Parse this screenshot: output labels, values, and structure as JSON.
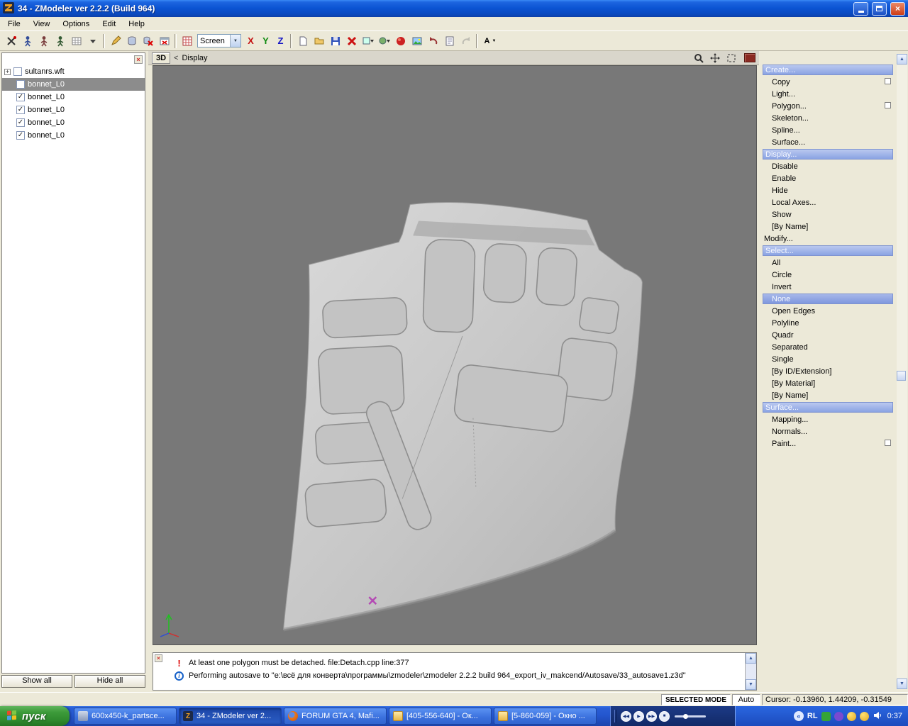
{
  "window": {
    "title": "34 - ZModeler ver 2.2.2 (Build 964)"
  },
  "menu": {
    "items": [
      "File",
      "View",
      "Options",
      "Edit",
      "Help"
    ]
  },
  "toolbar": {
    "screen_combo_value": "Screen",
    "axis_x": "X",
    "axis_y": "Y",
    "axis_z": "Z",
    "font_button": "A"
  },
  "left_panel": {
    "root_item": "sultanrs.wft",
    "items": [
      {
        "label": "bonnet_L0",
        "checked": false,
        "selected": true
      },
      {
        "label": "bonnet_L0",
        "checked": true,
        "selected": false
      },
      {
        "label": "bonnet_L0",
        "checked": true,
        "selected": false
      },
      {
        "label": "bonnet_L0",
        "checked": true,
        "selected": false
      },
      {
        "label": "bonnet_L0",
        "checked": true,
        "selected": false
      }
    ],
    "show_all_button": "Show all",
    "hide_all_button": "Hide all"
  },
  "viewport": {
    "tab_label": "3D",
    "back_arrow": "<",
    "view_label": "Display"
  },
  "command_panel": {
    "rows": [
      {
        "label": "Create...",
        "type": "header",
        "highlighted": true
      },
      {
        "label": "Copy",
        "type": "item",
        "checkbox": true
      },
      {
        "label": "Light...",
        "type": "item"
      },
      {
        "label": "Polygon...",
        "type": "item",
        "checkbox": true
      },
      {
        "label": "Skeleton...",
        "type": "item"
      },
      {
        "label": "Spline...",
        "type": "item"
      },
      {
        "label": "Surface...",
        "type": "item"
      },
      {
        "label": "Display...",
        "type": "header",
        "highlighted": true
      },
      {
        "label": "Disable",
        "type": "item"
      },
      {
        "label": "Enable",
        "type": "item"
      },
      {
        "label": "Hide",
        "type": "item"
      },
      {
        "label": "Local Axes...",
        "type": "item"
      },
      {
        "label": "Show",
        "type": "item"
      },
      {
        "label": "[By Name]",
        "type": "item"
      },
      {
        "label": "Modify...",
        "type": "header",
        "highlighted": false
      },
      {
        "label": "Select...",
        "type": "header",
        "highlighted": true
      },
      {
        "label": "All",
        "type": "item"
      },
      {
        "label": "Circle",
        "type": "item"
      },
      {
        "label": "Invert",
        "type": "item"
      },
      {
        "label": "None",
        "type": "item",
        "selected": true
      },
      {
        "label": "Open Edges",
        "type": "item"
      },
      {
        "label": "Polyline",
        "type": "item"
      },
      {
        "label": "Quadr",
        "type": "item"
      },
      {
        "label": "Separated",
        "type": "item"
      },
      {
        "label": "Single",
        "type": "item"
      },
      {
        "label": "[By ID/Extension]",
        "type": "item"
      },
      {
        "label": "[By Material]",
        "type": "item"
      },
      {
        "label": "[By Name]",
        "type": "item"
      },
      {
        "label": "Surface...",
        "type": "header",
        "highlighted": true
      },
      {
        "label": "Mapping...",
        "type": "item"
      },
      {
        "label": "Normals...",
        "type": "item"
      },
      {
        "label": "Paint...",
        "type": "item",
        "checkbox": true
      }
    ]
  },
  "log": {
    "messages": [
      {
        "icon": "warning",
        "text": "At least one polygon must be detached. file:Detach.cpp line:377"
      },
      {
        "icon": "info",
        "text": "Performing autosave to \"e:\\всё для конверта\\программы\\zmodeler\\zmodeler 2.2.2 build 964_export_iv_makcend/Autosave/33_autosave1.z3d\""
      }
    ]
  },
  "status_bar": {
    "mode": "SELECTED MODE",
    "auto_label": "Auto",
    "cursor": "Cursor: -0.13960, 1.44209, -0.31549"
  },
  "taskbar": {
    "start_label": "пуск",
    "tasks": [
      {
        "label": "600x450-k_partsce...",
        "active": false
      },
      {
        "label": "34 - ZModeler ver 2...",
        "active": true
      },
      {
        "label": "FORUM GTA 4, Mafi...",
        "active": false
      },
      {
        "label": "[405-556-640] - Ок...",
        "active": false
      },
      {
        "label": "[5-860-059] - Окно ...",
        "active": false
      }
    ],
    "tray": {
      "language": "RL",
      "time": "0:37"
    }
  }
}
